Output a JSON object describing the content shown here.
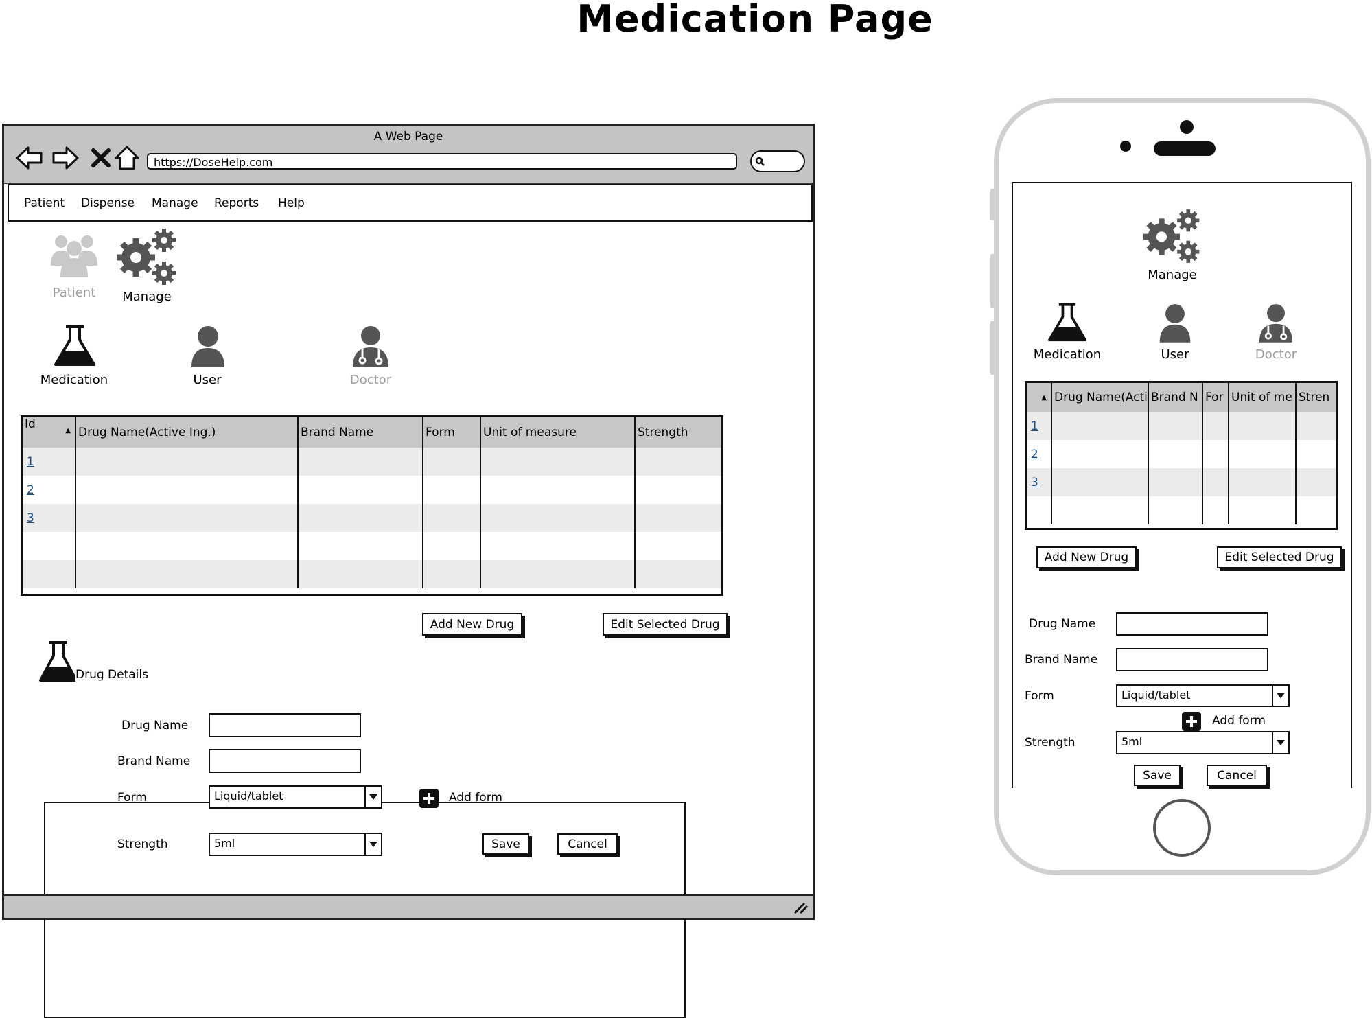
{
  "page": {
    "title": "Medication Page"
  },
  "browser": {
    "window_title": "A Web Page",
    "url": "https://DoseHelp.com",
    "menu": [
      "Patient",
      "Dispense",
      "Manage",
      "Reports",
      "Help"
    ]
  },
  "tiles": {
    "patient": "Patient",
    "manage": "Manage",
    "medication": "Medication",
    "user": "User",
    "doctor": "Doctor"
  },
  "desktop_table": {
    "columns": [
      "Id",
      "Drug Name(Active Ing.)",
      "Brand Name",
      "Form",
      "Unit of measure",
      "Strength"
    ],
    "rows": [
      {
        "id": "1"
      },
      {
        "id": "2"
      },
      {
        "id": "3"
      },
      {
        "id": ""
      },
      {
        "id": ""
      }
    ]
  },
  "mobile_table": {
    "columns": [
      "",
      "Drug Name(Acti",
      "Brand N",
      "For",
      "Unit of me",
      "Stren"
    ],
    "rows": [
      {
        "id": "1"
      },
      {
        "id": "2"
      },
      {
        "id": "3"
      },
      {
        "id": ""
      }
    ]
  },
  "actions": {
    "add": "Add New Drug",
    "edit": "Edit Selected Drug"
  },
  "drug_details": {
    "legend": "Drug Details",
    "drug_name_label": "Drug Name",
    "brand_name_label": "Brand Name",
    "form_label": "Form",
    "form_value": "Liquid/tablet",
    "add_form": "Add form",
    "strength_label": "Strength",
    "strength_value": "5ml",
    "save": "Save",
    "cancel": "Cancel"
  }
}
